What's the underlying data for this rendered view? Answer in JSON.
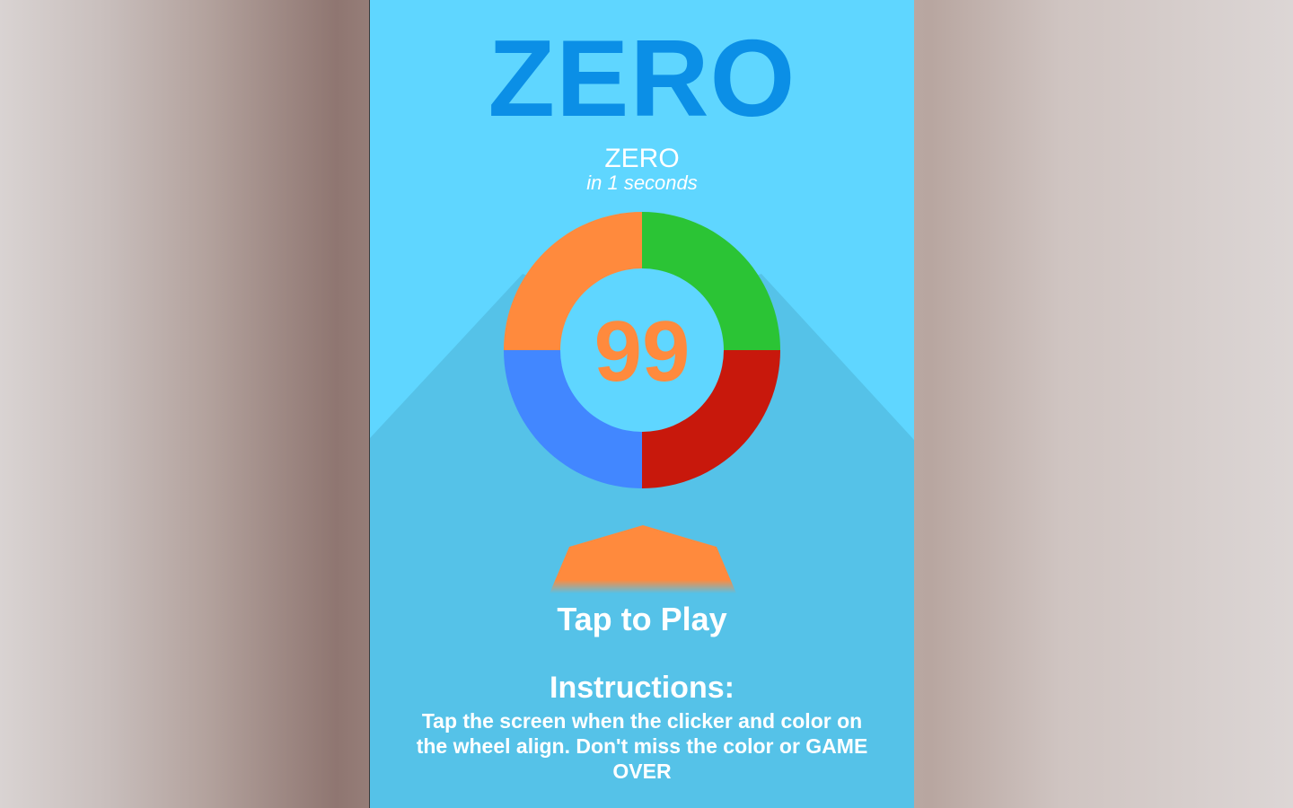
{
  "game": {
    "title": "ZERO",
    "best_label": "ZERO",
    "best_time": "in 1 seconds",
    "counter": "99",
    "tap_to_play": "Tap to Play",
    "instructions_title": "Instructions:",
    "instructions_text": "Tap the screen when the clicker and color on the wheel align. Don't miss the color or GAME OVER"
  },
  "colors": {
    "background": "#5fd6ff",
    "shadow": "#55c2e8",
    "title": "#0b8fe6",
    "counter": "#ff8a3d",
    "wheel_orange": "#ff8a3d",
    "wheel_green": "#2bc435",
    "wheel_red": "#c8180c",
    "wheel_blue": "#4287ff",
    "clicker": "#ff8a3d"
  },
  "icons": {
    "clicker": "pentagon-pointer-icon",
    "wheel": "four-color-ring"
  }
}
